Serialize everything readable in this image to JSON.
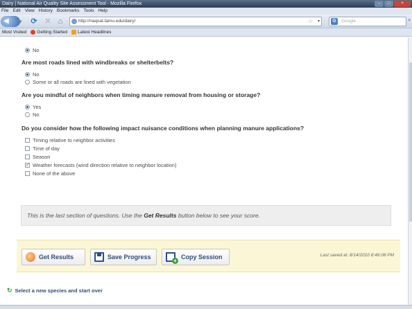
{
  "window": {
    "title": "Dairy | National Air Quality Site Assessment Tool - Mozilla Firefox",
    "controls": [
      "–",
      "□",
      "×"
    ]
  },
  "menu": [
    "File",
    "Edit",
    "View",
    "History",
    "Bookmarks",
    "Tools",
    "Help"
  ],
  "nav": {
    "url": "http://naqsat.tamu.edu/dairy/",
    "search_placeholder": "Google",
    "search_engine_icon": "G",
    "search_go": "⌕"
  },
  "bookmarks": [
    {
      "label": "Most Visited",
      "icon": "none"
    },
    {
      "label": "Getting Started",
      "icon": "firefox-icon"
    },
    {
      "label": "Latest Headlines",
      "icon": "rss-feed-icon"
    }
  ],
  "questions": {
    "q0": {
      "options": [
        {
          "label": "No",
          "selected": true
        }
      ]
    },
    "q1": {
      "title": "Are most roads lined with windbreaks or shelterbelts?",
      "options": [
        {
          "label": "No",
          "selected": true
        },
        {
          "label": "Some or all roads are lined with vegetation",
          "selected": false
        }
      ]
    },
    "q2": {
      "title": "Are you mindful of neighbors when timing manure removal from housing or storage?",
      "options": [
        {
          "label": "Yes",
          "selected": true
        },
        {
          "label": "No",
          "selected": false
        }
      ]
    },
    "q3": {
      "title": "Do you consider how the following impact nuisance conditions when planning manure applications?",
      "options": [
        {
          "label": "Timing relative to neighbor activities",
          "checked": false
        },
        {
          "label": "Time of day",
          "checked": false
        },
        {
          "label": "Season",
          "checked": false
        },
        {
          "label": "Weather forecasts (wind direction relative to neighbor location)",
          "checked": true
        },
        {
          "label": "None of the above",
          "checked": false
        }
      ]
    }
  },
  "note": {
    "before": "This is the last section of questions. Use the ",
    "emphasis": "Get Results",
    "after": " button below to see your score."
  },
  "actions": {
    "get_results": "Get Results",
    "save_progress": "Save Progress",
    "copy_session": "Copy Session",
    "last_saved": "Last saved at: 8/14/2010 8:46:08 PM"
  },
  "footer": {
    "start_over": "Select a new species and start over"
  },
  "colors": {
    "action_bar_bg": "#fbf6d6",
    "note_bg": "#eeeeee",
    "link_blue": "#2e4d7a",
    "start_over_icon": "#3aa13a"
  }
}
